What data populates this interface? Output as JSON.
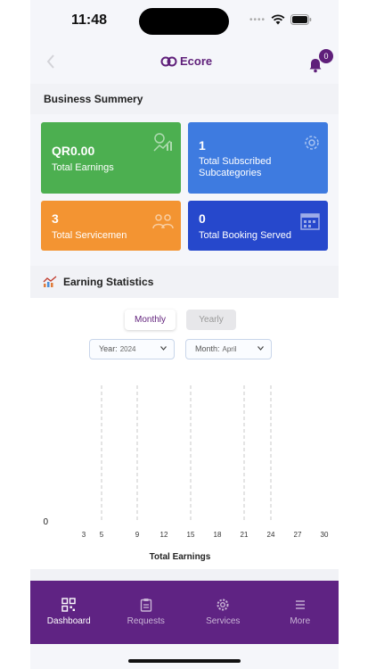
{
  "status": {
    "time": "11:48"
  },
  "header": {
    "logo_text": "Ecore",
    "notification_count": "0"
  },
  "business": {
    "title": "Business Summery",
    "cards": [
      {
        "value": "QR0.00",
        "label": "Total Earnings",
        "icon": "earnings-icon",
        "color": "#4caf50"
      },
      {
        "value": "1",
        "label": "Total Subscribed Subcategories",
        "icon": "gear-icon",
        "color": "#3e7be0"
      },
      {
        "value": "3",
        "label": "Total Servicemen",
        "icon": "servicemen-icon",
        "color": "#f39432"
      },
      {
        "value": "0",
        "label": "Total Booking Served",
        "icon": "calendar-icon",
        "color": "#2648cc"
      }
    ]
  },
  "stats": {
    "title": "Earning Statistics",
    "toggle": {
      "monthly": "Monthly",
      "yearly": "Yearly",
      "selected": "Monthly"
    },
    "year": {
      "label": "Year:",
      "value": "2024"
    },
    "month": {
      "label": "Month:",
      "value": "April"
    }
  },
  "chart_data": {
    "type": "line",
    "x": [
      3,
      5,
      9,
      12,
      15,
      18,
      21,
      24,
      27,
      30
    ],
    "y": [
      0,
      0,
      0,
      0,
      0,
      0,
      0,
      0,
      0,
      0
    ],
    "ytick_labels": [
      "0"
    ],
    "xtick_labels": [
      "3",
      "5",
      "9",
      "12",
      "15",
      "18",
      "21",
      "24",
      "27",
      "30"
    ],
    "xlabel": "Total Earnings",
    "dashed_gridlines_at": [
      5,
      9,
      15,
      21,
      24
    ],
    "grid": true
  },
  "nav": {
    "items": [
      {
        "label": "Dashboard",
        "icon": "dashboard-icon",
        "active": true
      },
      {
        "label": "Requests",
        "icon": "clipboard-icon",
        "active": false
      },
      {
        "label": "Services",
        "icon": "gear-icon",
        "active": false
      },
      {
        "label": "More",
        "icon": "menu-icon",
        "active": false
      }
    ]
  },
  "colors": {
    "brand": "#5f2383",
    "accent": "#5f1f7a",
    "line_start": "#e57373",
    "line_end": "#3f51b5"
  }
}
